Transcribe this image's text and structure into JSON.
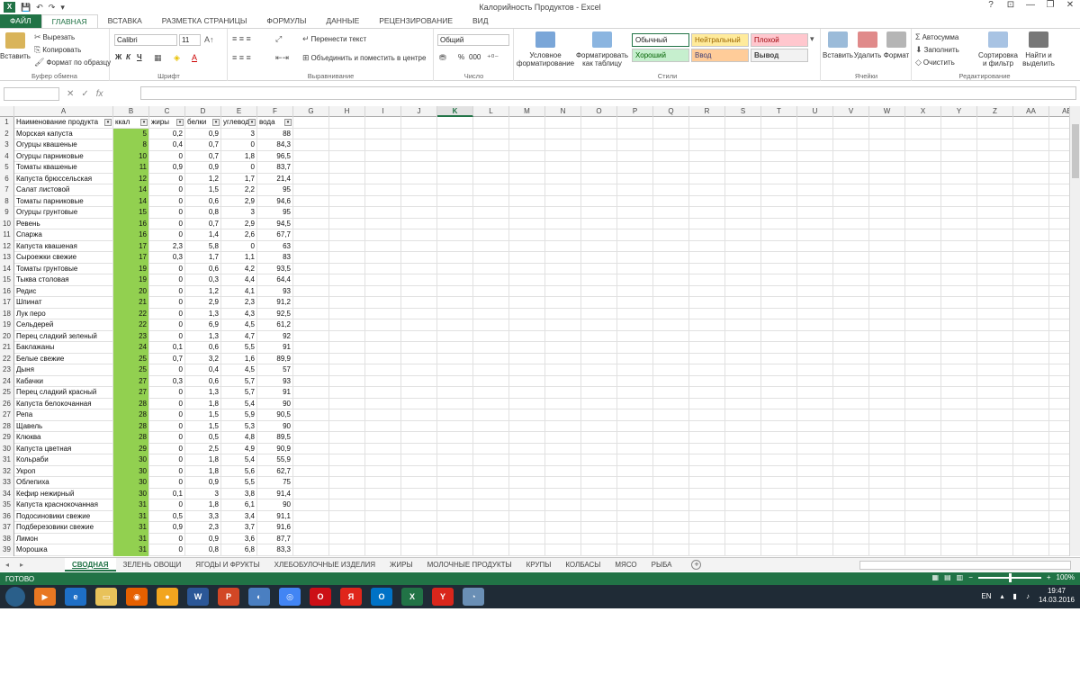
{
  "window": {
    "title": "Калорийность Продуктов - Excel",
    "help": "?",
    "minimize": "—",
    "restore": "❐",
    "close": "✕",
    "ribbon_display": "⊡"
  },
  "tabs": [
    "ФАЙЛ",
    "ГЛАВНАЯ",
    "ВСТАВКА",
    "РАЗМЕТКА СТРАНИЦЫ",
    "ФОРМУЛЫ",
    "ДАННЫЕ",
    "РЕЦЕНЗИРОВАНИЕ",
    "ВИД"
  ],
  "ribbon": {
    "clipboard": {
      "paste": "Вставить",
      "cut": "Вырезать",
      "copy": "Копировать",
      "format_painter": "Формат по образцу",
      "label": "Буфер обмена"
    },
    "font": {
      "name": "Calibri",
      "size": "11",
      "bold": "Ж",
      "italic": "К",
      "underline": "Ч",
      "label": "Шрифт"
    },
    "alignment": {
      "wrap": "Перенести текст",
      "merge": "Объединить и поместить в центре",
      "label": "Выравнивание"
    },
    "number": {
      "format": "Общий",
      "percent": "%",
      "thousands": "000",
      "label": "Число"
    },
    "styles": {
      "conditional": "Условное форматирование",
      "as_table": "Форматировать как таблицу",
      "normal": "Обычный",
      "neutral": "Нейтральный",
      "bad": "Плохой",
      "good": "Хороший",
      "input": "Ввод",
      "output": "Вывод",
      "label": "Стили"
    },
    "cells": {
      "insert": "Вставить",
      "delete": "Удалить",
      "format": "Формат",
      "label": "Ячейки"
    },
    "editing": {
      "autosum": "Автосумма",
      "fill": "Заполнить",
      "clear": "Очистить",
      "sort": "Сортировка и фильтр",
      "find": "Найти и выделить",
      "label": "Редактирование"
    }
  },
  "formula_bar": {
    "name_box": "",
    "fx": "fx",
    "value": ""
  },
  "columns": [
    "A",
    "B",
    "C",
    "D",
    "E",
    "F",
    "G",
    "H",
    "I",
    "J",
    "K",
    "L",
    "M",
    "N",
    "O",
    "P",
    "Q",
    "R",
    "S",
    "T",
    "U",
    "V",
    "W",
    "X",
    "Y",
    "Z",
    "AA",
    "AB"
  ],
  "selected_column": "K",
  "headers": [
    "Наименование продукта",
    "ккал",
    "жиры",
    "белки",
    "углеводы",
    "вода"
  ],
  "rows": [
    [
      "Морская капуста",
      "5",
      "0,2",
      "0,9",
      "3",
      "88"
    ],
    [
      "Огурцы квашеные",
      "8",
      "0,4",
      "0,7",
      "0",
      "84,3"
    ],
    [
      "Огурцы парниковые",
      "10",
      "0",
      "0,7",
      "1,8",
      "96,5"
    ],
    [
      "Томаты квашеные",
      "11",
      "0,9",
      "0,9",
      "0",
      "83,7"
    ],
    [
      "Капуста брюссельская",
      "12",
      "0",
      "1,2",
      "1,7",
      "21,4"
    ],
    [
      "Салат листовой",
      "14",
      "0",
      "1,5",
      "2,2",
      "95"
    ],
    [
      "Томаты парниковые",
      "14",
      "0",
      "0,6",
      "2,9",
      "94,6"
    ],
    [
      "Огурцы грунтовые",
      "15",
      "0",
      "0,8",
      "3",
      "95"
    ],
    [
      "Ревень",
      "16",
      "0",
      "0,7",
      "2,9",
      "94,5"
    ],
    [
      "Спаржа",
      "16",
      "0",
      "1,4",
      "2,6",
      "67,7"
    ],
    [
      "Капуста квашеная",
      "17",
      "2,3",
      "5,8",
      "0",
      "63"
    ],
    [
      "Сыроежки свежие",
      "17",
      "0,3",
      "1,7",
      "1,1",
      "83"
    ],
    [
      "Томаты грунтовые",
      "19",
      "0",
      "0,6",
      "4,2",
      "93,5"
    ],
    [
      "Тыква столовая",
      "19",
      "0",
      "0,3",
      "4,4",
      "64,4"
    ],
    [
      "Редис",
      "20",
      "0",
      "1,2",
      "4,1",
      "93"
    ],
    [
      "Шпинат",
      "21",
      "0",
      "2,9",
      "2,3",
      "91,2"
    ],
    [
      "Лук перо",
      "22",
      "0",
      "1,3",
      "4,3",
      "92,5"
    ],
    [
      "Сельдерей",
      "22",
      "0",
      "6,9",
      "4,5",
      "61,2"
    ],
    [
      "Перец сладкий зеленый",
      "23",
      "0",
      "1,3",
      "4,7",
      "92"
    ],
    [
      "Баклажаны",
      "24",
      "0,1",
      "0,6",
      "5,5",
      "91"
    ],
    [
      "Белые свежие",
      "25",
      "0,7",
      "3,2",
      "1,6",
      "89,9"
    ],
    [
      "Дыня",
      "25",
      "0",
      "0,4",
      "4,5",
      "57"
    ],
    [
      "Кабачки",
      "27",
      "0,3",
      "0,6",
      "5,7",
      "93"
    ],
    [
      "Перец сладкий красный",
      "27",
      "0",
      "1,3",
      "5,7",
      "91"
    ],
    [
      "Капуста белокочанная",
      "28",
      "0",
      "1,8",
      "5,4",
      "90"
    ],
    [
      "Репа",
      "28",
      "0",
      "1,5",
      "5,9",
      "90,5"
    ],
    [
      "Щавель",
      "28",
      "0",
      "1,5",
      "5,3",
      "90"
    ],
    [
      "Клюква",
      "28",
      "0",
      "0,5",
      "4,8",
      "89,5"
    ],
    [
      "Капуста цветная",
      "29",
      "0",
      "2,5",
      "4,9",
      "90,9"
    ],
    [
      "Кольраби",
      "30",
      "0",
      "1,8",
      "5,4",
      "55,9"
    ],
    [
      "Укроп",
      "30",
      "0",
      "1,8",
      "5,6",
      "62,7"
    ],
    [
      "Облепиха",
      "30",
      "0",
      "0,9",
      "5,5",
      "75"
    ],
    [
      "Кефир нежирный",
      "30",
      "0,1",
      "3",
      "3,8",
      "91,4"
    ],
    [
      "Капуста краснокочанная",
      "31",
      "0",
      "1,8",
      "6,1",
      "90"
    ],
    [
      "Подосиновики свежие",
      "31",
      "0,5",
      "3,3",
      "3,4",
      "91,1"
    ],
    [
      "Подберезовики свежие",
      "31",
      "0,9",
      "2,3",
      "3,7",
      "91,6"
    ],
    [
      "Лимон",
      "31",
      "0",
      "0,9",
      "3,6",
      "87,7"
    ],
    [
      "Морошка",
      "31",
      "0",
      "0,8",
      "6,8",
      "83,3"
    ]
  ],
  "sheet_tabs": [
    "СВОДНАЯ",
    "ЗЕЛЕНЬ ОВОЩИ",
    "ЯГОДЫ И ФРУКТЫ",
    "ХЛЕБОБУЛОЧНЫЕ ИЗДЕЛИЯ",
    "ЖИРЫ",
    "МОЛОЧНЫЕ ПРОДУКТЫ",
    "КРУПЫ",
    "КОЛБАСЫ",
    "МЯСО",
    "РЫБА"
  ],
  "status": {
    "ready": "ГОТОВО",
    "zoom": "100%"
  },
  "taskbar": {
    "lang": "EN",
    "time": "19:47",
    "date": "14.03.2016"
  },
  "colors": {
    "excel_green": "#217346",
    "kcal_fill": "#92d050"
  }
}
